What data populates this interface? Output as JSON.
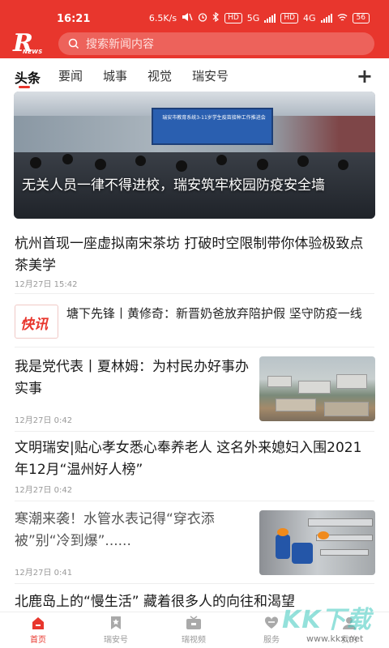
{
  "status_bar": {
    "time": "16:21",
    "speed": "6.5K/s",
    "net1": "5G",
    "net2": "4G",
    "battery": "56"
  },
  "header": {
    "logo_letter": "R",
    "logo_word": "NEWS",
    "search_placeholder": "搜索新闻内容"
  },
  "tabs": [
    {
      "label": "头条",
      "active": true
    },
    {
      "label": "要闻"
    },
    {
      "label": "城事"
    },
    {
      "label": "视觉"
    },
    {
      "label": "瑞安号"
    }
  ],
  "hero": {
    "caption": "无关人员一律不得进校，瑞安筑牢校园防疫安全墙",
    "screen_text": "瑞安市教育系统3-11岁学生疫苗接种工作推进会"
  },
  "news": [
    {
      "title": "杭州首现一座虚拟南宋茶坊 打破时空限制带你体验极致点茶美学",
      "time": "12月27日 15:42"
    },
    {
      "title": "我是党代表丨夏林姆：为村民办好事办实事",
      "time": "12月27日 0:42"
    },
    {
      "title": "文明瑞安|贴心孝女悉心奉养老人 这名外来媳妇入围2021年12月“温州好人榜”",
      "time": "12月27日 0:42"
    },
    {
      "title": "寒潮来袭！水管水表记得“穿衣添被”别“冷到爆”......",
      "time": "12月27日 0:41"
    },
    {
      "title": "北鹿岛上的“慢生活” 藏着很多人的向往和渴望"
    }
  ],
  "flash": {
    "badge": "快讯",
    "text": "塘下先锋丨黄修奇：新晋奶爸放弃陪护假 坚守防疫一线"
  },
  "bottom_nav": [
    {
      "label": "首页",
      "active": true
    },
    {
      "label": "瑞安号"
    },
    {
      "label": "瑞视频"
    },
    {
      "label": "服务"
    },
    {
      "label": "我的"
    }
  ],
  "watermark": {
    "text": "KK下载",
    "url": "www.kkx.net"
  },
  "colors": {
    "brand_red": "#e8362d"
  }
}
